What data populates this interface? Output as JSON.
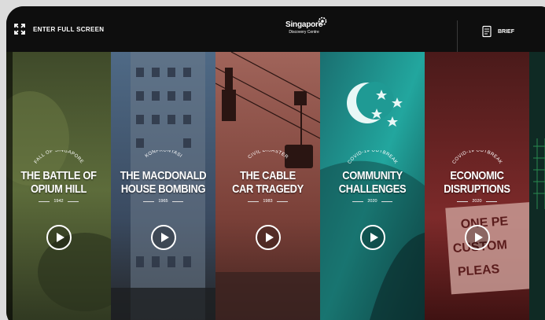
{
  "header": {
    "fullscreen_label": "ENTER FULL SCREEN",
    "logo_name": "Singapore",
    "logo_sub": "Discovery Centre",
    "brief_label": "BRIEF"
  },
  "panels": [
    {
      "category": "FALL OF SINGAPORE",
      "title_line1": "THE BATTLE OF",
      "title_line2": "OPIUM HILL",
      "year": "1942",
      "color": "#5a6a3a"
    },
    {
      "category": "KONFRONTASI",
      "title_line1": "THE MACDONALD",
      "title_line2": "HOUSE BOMBING",
      "year": "1965",
      "color": "#3e4e66"
    },
    {
      "category": "CIVIL DISASTER",
      "title_line1": "THE CABLE",
      "title_line2": "CAR TRAGEDY",
      "year": "1983",
      "color": "#8a4a42"
    },
    {
      "category": "COVID-19 OUTBREAK",
      "title_line1": "COMMUNITY",
      "title_line2": "CHALLENGES",
      "year": "2020",
      "color": "#1f9e96"
    },
    {
      "category": "COVID-19 OUTBREAK",
      "title_line1": "ECONOMIC",
      "title_line2": "DISRUPTIONS",
      "year": "2020",
      "color": "#7a2a2a"
    }
  ],
  "background_sign": "ONE PE CUSTOM PLEAS"
}
